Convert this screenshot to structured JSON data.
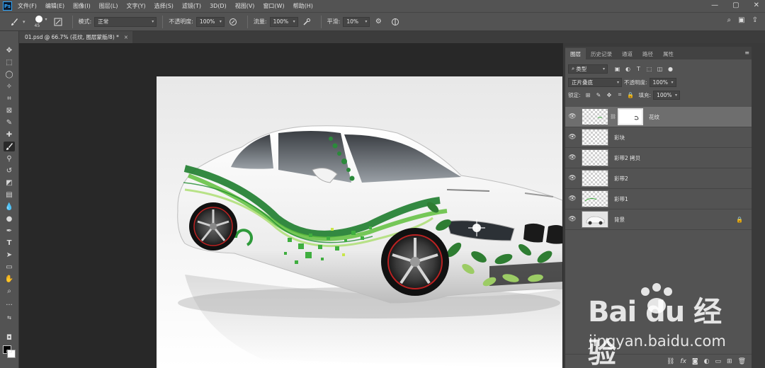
{
  "app": {
    "logo": "Ps"
  },
  "menu": [
    "文件(F)",
    "编辑(E)",
    "图像(I)",
    "图层(L)",
    "文字(Y)",
    "选择(S)",
    "滤镜(T)",
    "3D(D)",
    "视图(V)",
    "窗口(W)",
    "帮助(H)"
  ],
  "window_controls": [
    "—",
    "▢",
    "✕"
  ],
  "options": {
    "brush_size": "45",
    "mode_label": "模式:",
    "mode_value": "正常",
    "opacity_label": "不透明度:",
    "opacity_value": "100%",
    "flow_label": "流量:",
    "flow_value": "100%",
    "smooth_label": "平滑:",
    "smooth_value": "10%"
  },
  "document_tab": {
    "title": "01.psd @ 66.7% (花纹, 图层蒙版/8) *",
    "close": "×"
  },
  "panel": {
    "tabs": [
      "图层",
      "历史记录",
      "通道",
      "路径",
      "属性"
    ],
    "filter_kind": "类型",
    "blend_mode": "正片叠底",
    "opacity_label": "不透明度:",
    "opacity_value": "100%",
    "lock_label": "锁定:",
    "fill_label": "填充:",
    "fill_value": "100%",
    "layers": [
      {
        "name": "花纹",
        "visible": true,
        "selected": true,
        "has_mask": true
      },
      {
        "name": "彩块",
        "visible": true
      },
      {
        "name": "彩带2 拷贝",
        "visible": true
      },
      {
        "name": "彩带2",
        "visible": true
      },
      {
        "name": "彩带1",
        "visible": true
      },
      {
        "name": "背景",
        "visible": true,
        "locked": true
      }
    ]
  },
  "watermark": {
    "brand": "Bai du 经验",
    "url": "jingyan.baidu.com"
  },
  "colors": {
    "accent": "#31a8ff",
    "ui_dark": "#282828",
    "ui_mid": "#535353",
    "selected_layer": "#6e6e6e",
    "car_green": "#1e8a2e"
  }
}
